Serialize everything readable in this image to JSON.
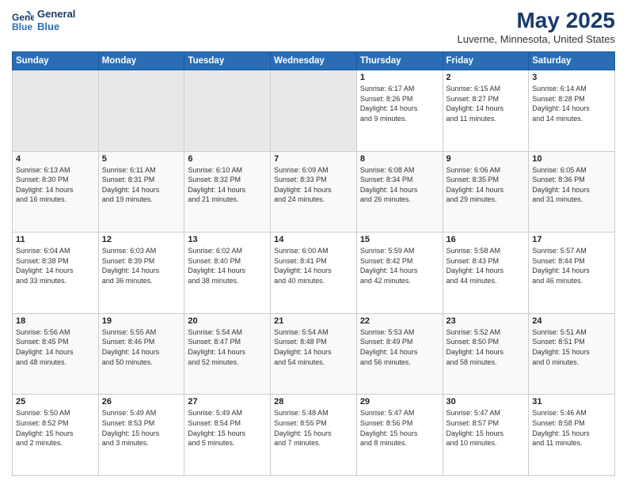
{
  "header": {
    "logo_line1": "General",
    "logo_line2": "Blue",
    "month": "May 2025",
    "location": "Luverne, Minnesota, United States"
  },
  "weekdays": [
    "Sunday",
    "Monday",
    "Tuesday",
    "Wednesday",
    "Thursday",
    "Friday",
    "Saturday"
  ],
  "rows": [
    [
      {
        "day": "",
        "info": ""
      },
      {
        "day": "",
        "info": ""
      },
      {
        "day": "",
        "info": ""
      },
      {
        "day": "",
        "info": ""
      },
      {
        "day": "1",
        "info": "Sunrise: 6:17 AM\nSunset: 8:26 PM\nDaylight: 14 hours\nand 9 minutes."
      },
      {
        "day": "2",
        "info": "Sunrise: 6:15 AM\nSunset: 8:27 PM\nDaylight: 14 hours\nand 11 minutes."
      },
      {
        "day": "3",
        "info": "Sunrise: 6:14 AM\nSunset: 8:28 PM\nDaylight: 14 hours\nand 14 minutes."
      }
    ],
    [
      {
        "day": "4",
        "info": "Sunrise: 6:13 AM\nSunset: 8:30 PM\nDaylight: 14 hours\nand 16 minutes."
      },
      {
        "day": "5",
        "info": "Sunrise: 6:11 AM\nSunset: 8:31 PM\nDaylight: 14 hours\nand 19 minutes."
      },
      {
        "day": "6",
        "info": "Sunrise: 6:10 AM\nSunset: 8:32 PM\nDaylight: 14 hours\nand 21 minutes."
      },
      {
        "day": "7",
        "info": "Sunrise: 6:09 AM\nSunset: 8:33 PM\nDaylight: 14 hours\nand 24 minutes."
      },
      {
        "day": "8",
        "info": "Sunrise: 6:08 AM\nSunset: 8:34 PM\nDaylight: 14 hours\nand 26 minutes."
      },
      {
        "day": "9",
        "info": "Sunrise: 6:06 AM\nSunset: 8:35 PM\nDaylight: 14 hours\nand 29 minutes."
      },
      {
        "day": "10",
        "info": "Sunrise: 6:05 AM\nSunset: 8:36 PM\nDaylight: 14 hours\nand 31 minutes."
      }
    ],
    [
      {
        "day": "11",
        "info": "Sunrise: 6:04 AM\nSunset: 8:38 PM\nDaylight: 14 hours\nand 33 minutes."
      },
      {
        "day": "12",
        "info": "Sunrise: 6:03 AM\nSunset: 8:39 PM\nDaylight: 14 hours\nand 36 minutes."
      },
      {
        "day": "13",
        "info": "Sunrise: 6:02 AM\nSunset: 8:40 PM\nDaylight: 14 hours\nand 38 minutes."
      },
      {
        "day": "14",
        "info": "Sunrise: 6:00 AM\nSunset: 8:41 PM\nDaylight: 14 hours\nand 40 minutes."
      },
      {
        "day": "15",
        "info": "Sunrise: 5:59 AM\nSunset: 8:42 PM\nDaylight: 14 hours\nand 42 minutes."
      },
      {
        "day": "16",
        "info": "Sunrise: 5:58 AM\nSunset: 8:43 PM\nDaylight: 14 hours\nand 44 minutes."
      },
      {
        "day": "17",
        "info": "Sunrise: 5:57 AM\nSunset: 8:44 PM\nDaylight: 14 hours\nand 46 minutes."
      }
    ],
    [
      {
        "day": "18",
        "info": "Sunrise: 5:56 AM\nSunset: 8:45 PM\nDaylight: 14 hours\nand 48 minutes."
      },
      {
        "day": "19",
        "info": "Sunrise: 5:55 AM\nSunset: 8:46 PM\nDaylight: 14 hours\nand 50 minutes."
      },
      {
        "day": "20",
        "info": "Sunrise: 5:54 AM\nSunset: 8:47 PM\nDaylight: 14 hours\nand 52 minutes."
      },
      {
        "day": "21",
        "info": "Sunrise: 5:54 AM\nSunset: 8:48 PM\nDaylight: 14 hours\nand 54 minutes."
      },
      {
        "day": "22",
        "info": "Sunrise: 5:53 AM\nSunset: 8:49 PM\nDaylight: 14 hours\nand 56 minutes."
      },
      {
        "day": "23",
        "info": "Sunrise: 5:52 AM\nSunset: 8:50 PM\nDaylight: 14 hours\nand 58 minutes."
      },
      {
        "day": "24",
        "info": "Sunrise: 5:51 AM\nSunset: 8:51 PM\nDaylight: 15 hours\nand 0 minutes."
      }
    ],
    [
      {
        "day": "25",
        "info": "Sunrise: 5:50 AM\nSunset: 8:52 PM\nDaylight: 15 hours\nand 2 minutes."
      },
      {
        "day": "26",
        "info": "Sunrise: 5:49 AM\nSunset: 8:53 PM\nDaylight: 15 hours\nand 3 minutes."
      },
      {
        "day": "27",
        "info": "Sunrise: 5:49 AM\nSunset: 8:54 PM\nDaylight: 15 hours\nand 5 minutes."
      },
      {
        "day": "28",
        "info": "Sunrise: 5:48 AM\nSunset: 8:55 PM\nDaylight: 15 hours\nand 7 minutes."
      },
      {
        "day": "29",
        "info": "Sunrise: 5:47 AM\nSunset: 8:56 PM\nDaylight: 15 hours\nand 8 minutes."
      },
      {
        "day": "30",
        "info": "Sunrise: 5:47 AM\nSunset: 8:57 PM\nDaylight: 15 hours\nand 10 minutes."
      },
      {
        "day": "31",
        "info": "Sunrise: 5:46 AM\nSunset: 8:58 PM\nDaylight: 15 hours\nand 11 minutes."
      }
    ]
  ]
}
